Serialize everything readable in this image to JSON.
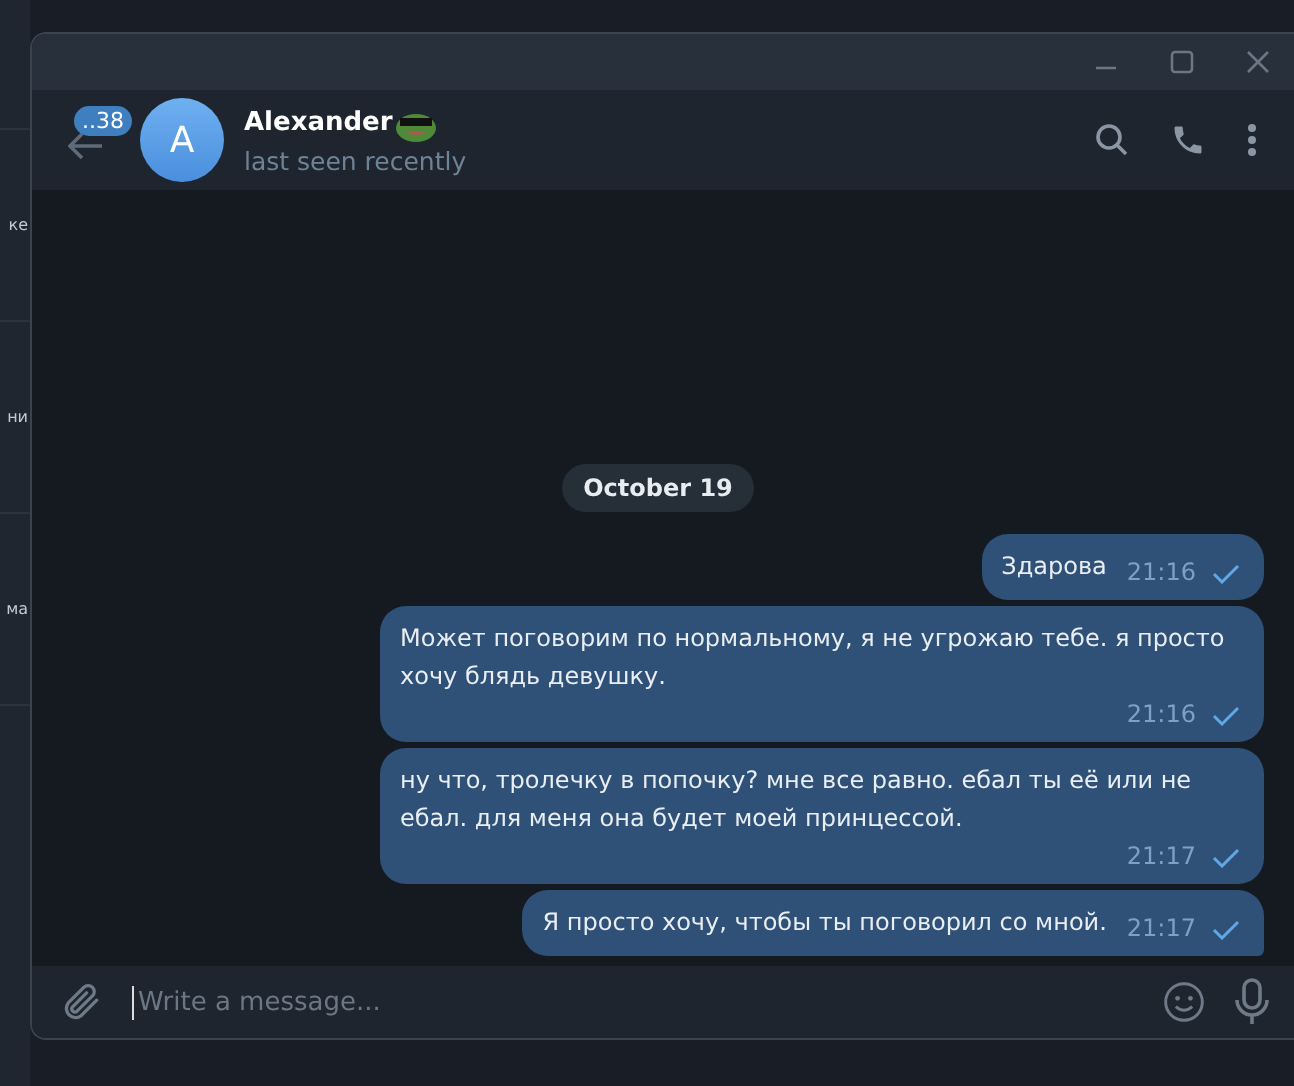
{
  "background_window": {
    "items": [
      "ке",
      "ни",
      "ма"
    ]
  },
  "header": {
    "unread_count": "..38",
    "avatar_letter": "A",
    "name": "Alexander",
    "status": "last seen recently"
  },
  "date": "October 19",
  "messages": [
    {
      "text": "Здарова",
      "time": "21:16",
      "read": false
    },
    {
      "text": "Может поговорим по нормальному, я не угрожаю тебе. я просто хочу блядь девушку.",
      "time": "21:16",
      "read": false
    },
    {
      "text": "ну что, тролечку в попочку? мне все равно. ебал ты её или не ебал. для меня она будет моей принцессой.",
      "time": "21:17",
      "read": false
    },
    {
      "text": "Я просто хочу, чтобы ты поговорил со мной.",
      "time": "21:17",
      "read": false
    }
  ],
  "composer": {
    "placeholder": "Write a message..."
  }
}
